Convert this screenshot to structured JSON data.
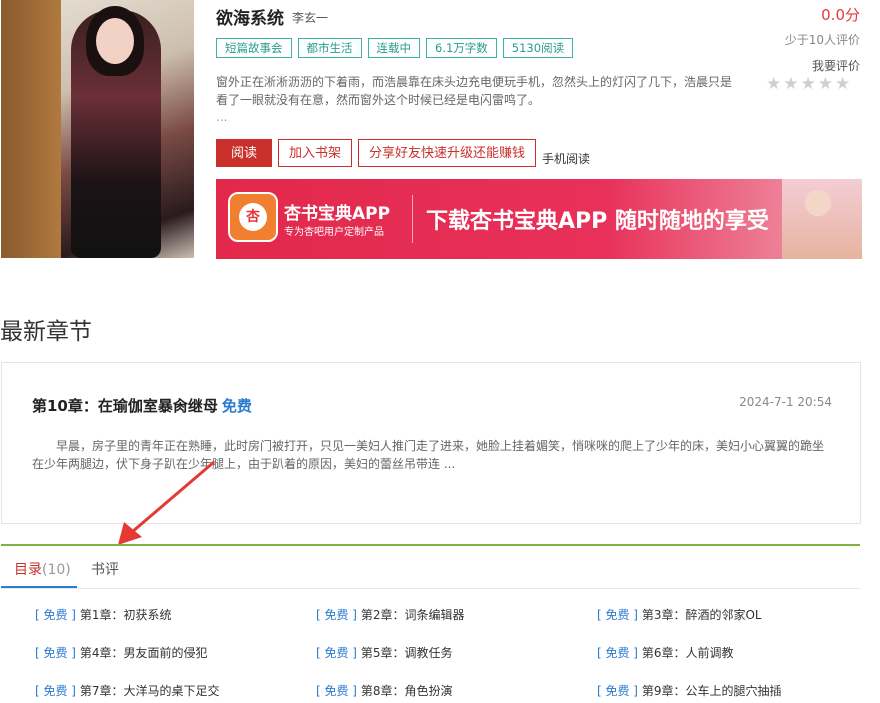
{
  "book": {
    "title": "欲海系统",
    "author": "李玄一",
    "score": "0.0分",
    "rating_count": "少于10人评价",
    "rate_link": "我要评价",
    "stars": "★★★★★",
    "tags": [
      "短篇故事会",
      "都市生活",
      "连载中",
      "6.1万字数",
      "5130阅读"
    ],
    "description": "窗外正在淅淅沥沥的下着雨，而浩晨靠在床头边充电便玩手机，忽然头上的灯闪了几下，浩晨只是看了一眼就没有在意，然而窗外这个时候已经是电闪雷鸣了。",
    "desc_ellipsis": "..."
  },
  "actions": {
    "read": "阅读",
    "add_shelf": "加入书架",
    "share": "分享好友快速升级还能赚钱",
    "mobile": "手机阅读"
  },
  "banner": {
    "logo_char": "杏",
    "app_name": "杏书宝典APP",
    "app_sub": "专为杏吧用户定制产品",
    "slogan": "下载杏书宝典APP 随时随地的享受"
  },
  "latest": {
    "section_title": "最新章节",
    "chapter_title": "第10章：在瑜伽室暴肏继母",
    "free_label": "免费",
    "date": "2024-7-1 20:54",
    "excerpt": "早晨，房子里的青年正在熟睡，此时房门被打开，只见一美妇人推门走了进来，她脸上挂着媚笑，悄咪咪的爬上了少年的床，美妇小心翼翼的跪坐在少年两腿边，伏下身子趴在少年腿上，由于趴着的原因，美妇的蕾丝吊带连 ..."
  },
  "tabs": {
    "catalog": "目录",
    "catalog_count": "(10)",
    "reviews": "书评"
  },
  "toc": [
    {
      "tag": "[ 免费 ]",
      "name": "第1章：初获系统"
    },
    {
      "tag": "[ 免费 ]",
      "name": "第2章：词条编辑器"
    },
    {
      "tag": "[ 免费 ]",
      "name": "第3章：醉酒的邻家OL"
    },
    {
      "tag": "[ 免费 ]",
      "name": "第4章：男友面前的侵犯"
    },
    {
      "tag": "[ 免费 ]",
      "name": "第5章：调教任务"
    },
    {
      "tag": "[ 免费 ]",
      "name": "第6章：人前调教"
    },
    {
      "tag": "[ 免费 ]",
      "name": "第7章：大洋马的桌下足交"
    },
    {
      "tag": "[ 免费 ]",
      "name": "第8章：角色扮演"
    },
    {
      "tag": "[ 免费 ]",
      "name": "第9章：公车上的腿穴抽插"
    }
  ],
  "colors": {
    "accent_red": "#c9302c",
    "link_blue": "#2b7bd0",
    "tag_teal": "#3cb4a6",
    "tab_border_green": "#7cb342"
  }
}
